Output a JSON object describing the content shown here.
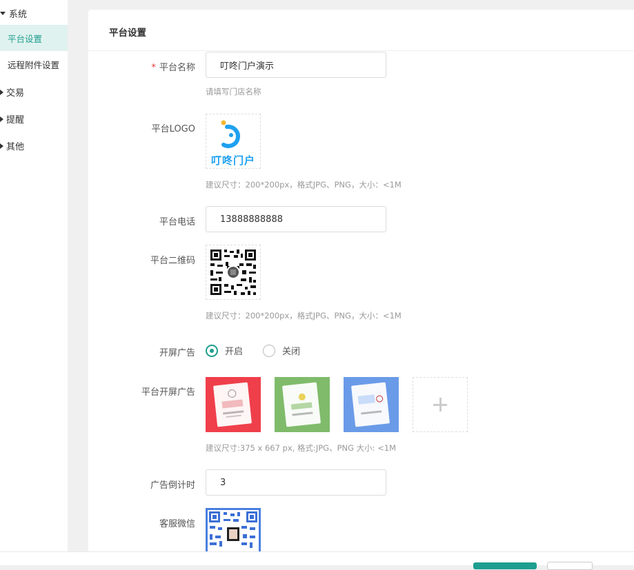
{
  "sidebar": {
    "groups": [
      {
        "label": "系统",
        "expanded": true
      },
      {
        "label": "交易",
        "expanded": false
      },
      {
        "label": "提醒",
        "expanded": false
      },
      {
        "label": "其他",
        "expanded": false
      }
    ],
    "system_items": [
      {
        "label": "平台设置",
        "active": true
      },
      {
        "label": "远程附件设置",
        "active": false
      }
    ]
  },
  "page": {
    "title": "平台设置"
  },
  "form": {
    "name_label": "平台名称",
    "name_required": "*",
    "name_value": "叮咚门户演示",
    "name_hint": "请填写门店名称",
    "logo_label": "平台LOGO",
    "logo_text": "叮咚门户",
    "logo_hint": "建议尺寸：200*200px，格式JPG、PNG，大小：<1M",
    "phone_label": "平台电话",
    "phone_value": "13888888888",
    "qrcode_label": "平台二维码",
    "qrcode_hint": "建议尺寸：200*200px，格式JPG、PNG，大小：<1M",
    "splash_label": "开屏广告",
    "splash_on": "开启",
    "splash_off": "关闭",
    "splash_selected": "on",
    "splash_ads_label": "平台开屏广告",
    "splash_ads_hint": "建议尺寸:375 x 667 px, 格式:JPG、PNG 大小: <1M",
    "countdown_label": "广告倒计时",
    "countdown_value": "3",
    "wechat_label": "客服微信"
  },
  "colors": {
    "accent": "#1e9e8f",
    "ad_red": "#ef3f4a",
    "ad_green": "#7fbb6b",
    "ad_blue": "#6a9be8",
    "logo_blue": "#1ea0f0",
    "logo_yellow": "#f5b82e"
  }
}
